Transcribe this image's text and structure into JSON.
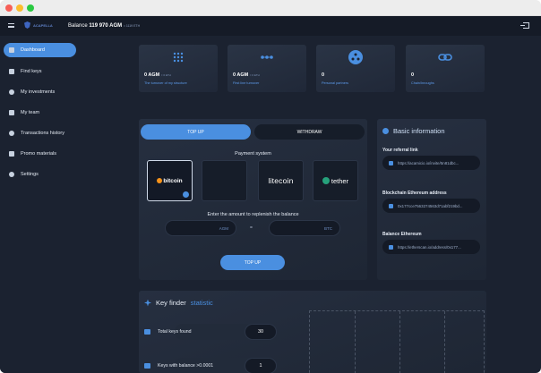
{
  "topbar": {
    "logo_text": "ACAPELLA",
    "balance_label": "Balance",
    "balance_value": "119 970 AGM",
    "balance_sub": "= 1119 ETH",
    "logout_icon": "logout-icon"
  },
  "sidebar": {
    "items": [
      {
        "label": "Dashboard",
        "icon": "dashboard-icon",
        "active": true
      },
      {
        "label": "Find keys",
        "icon": "key-icon"
      },
      {
        "label": "My investments",
        "icon": "dollar-icon"
      },
      {
        "label": "My team",
        "icon": "team-icon"
      },
      {
        "label": "Transactions history",
        "icon": "history-icon"
      },
      {
        "label": "Promo materials",
        "icon": "share-icon"
      },
      {
        "label": "Settings",
        "icon": "gear-icon"
      }
    ]
  },
  "cards": [
    {
      "value": "0 AGM",
      "sub": "= 0 ETH",
      "label": "The turnover of my structure",
      "icon": "grid-dots-icon"
    },
    {
      "value": "0 AGM",
      "sub": "= 0 ETH",
      "label": "First line turnover",
      "icon": "chain-icon"
    },
    {
      "value": "0",
      "sub": "",
      "label": "Personal partners",
      "icon": "team-icon"
    },
    {
      "value": "0",
      "sub": "",
      "label": "Chain/Inroughs",
      "icon": "link-icon"
    }
  ],
  "topup": {
    "tabs": [
      "TOP UP",
      "WITHDRAW"
    ],
    "payment_title": "Payment system",
    "payment_options": [
      "bitcoin",
      "",
      "litecoin",
      "tether"
    ],
    "enter_title": "Enter the amount to replenish the balance",
    "agm_placeholder": "AGM",
    "btc_placeholder": "BTC",
    "equals": "=",
    "button": "TOP UP"
  },
  "basic_info": {
    "title": "Basic information",
    "referral_label": "Your referral link",
    "referral_value": "https://acamicio.io/invite/5n81dbc...",
    "eth_address_label": "Blockchain Ethereum address",
    "eth_address_value": "0x177cce7563274563d71abf219bd...",
    "balance_eth_label": "Balance Ethereum",
    "balance_eth_value": "https://etherscan.io/address/0x177..."
  },
  "key_stats": {
    "title_plain": "Key finder",
    "title_highlight": "statistic",
    "rows": [
      {
        "label": "Total keys found",
        "value": "30"
      },
      {
        "label": "Keys with balance >0.0001",
        "value": "1"
      }
    ]
  }
}
